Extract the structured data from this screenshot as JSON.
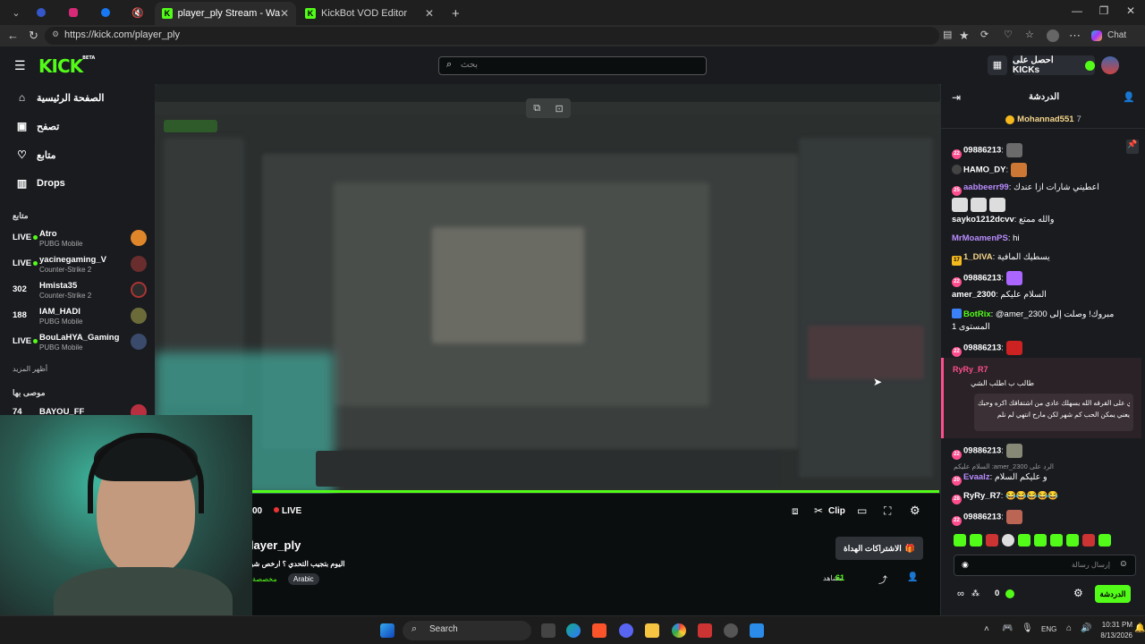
{
  "browser": {
    "tabs": [
      {
        "title": "player_ply Stream - Watch Live on Kick",
        "active": true
      },
      {
        "title": "KickBot VOD Editor",
        "active": false
      }
    ],
    "new_tab": "+",
    "url": "https://kick.com/player_ply",
    "copilot_label": "Chat"
  },
  "header": {
    "logo": "KICK",
    "logo_badge": "BETA",
    "search_placeholder": "بحث",
    "kicks_button": "احصل على KICKs"
  },
  "sidebar": {
    "nav": [
      {
        "label": "الصفحة الرئيسية",
        "icon": "home-icon"
      },
      {
        "label": "تصفح",
        "icon": "browse-icon"
      },
      {
        "label": "متابع",
        "icon": "heart-icon"
      },
      {
        "label": "Drops",
        "icon": "drops-icon"
      }
    ],
    "following_title": "متابع",
    "following": [
      {
        "status": "LIVE",
        "name": "Atro",
        "game": "PUBG Mobile"
      },
      {
        "status": "LIVE",
        "name": "yacinegaming_V",
        "game": "Counter-Strike 2"
      },
      {
        "status": "302",
        "name": "Hmista35",
        "game": "Counter-Strike 2"
      },
      {
        "status": "188",
        "name": "IAM_HADI",
        "game": "PUBG Mobile"
      },
      {
        "status": "LIVE",
        "name": "BouLaHYA_Gaming",
        "game": "PUBG Mobile"
      }
    ],
    "show_more": "أظهر المزيد",
    "recommended_title": "موصى بها",
    "recommended": [
      {
        "status": "74",
        "name": "BAYOU_FF"
      }
    ]
  },
  "player": {
    "time": "00",
    "live_label": "LIVE",
    "clip_label": "Clip"
  },
  "stream_info": {
    "channel": "player_ply",
    "title": "اليوم بتجيب التحدي ؟ ارخص شوب",
    "category": "مخصصة",
    "tag": "Arabic",
    "gift_button": "الاشتراكات الهداة",
    "viewers_label": "مشاهد",
    "viewers": "61"
  },
  "chat": {
    "title": "الدردشة",
    "pinned_user": "Mohannad551",
    "pinned_count": "7",
    "messages": [
      {
        "badge": "22",
        "user": "09886213",
        "text": "",
        "color": "#ffffff",
        "emote": true
      },
      {
        "badge": "",
        "user": "HAMO_DY",
        "text": "",
        "color": "#ffffff",
        "emote": true
      },
      {
        "badge": "25",
        "user": "aabbeerr99",
        "text": "اعطيني شارات ازا عندك",
        "color": "#ffffff"
      },
      {
        "badge": "",
        "user": "sayko1212dcvv",
        "text": "والله ممتع",
        "color": "#ffffff"
      },
      {
        "badge": "",
        "user": "MrMoamenPS",
        "text": "hi",
        "color": "#b98cff"
      },
      {
        "badge": "17",
        "user": "1_DIVA",
        "text": "يسطيك المافية",
        "color": "#ffffff"
      },
      {
        "badge": "22",
        "user": "09886213",
        "text": "",
        "color": "#ffffff",
        "emote": true
      },
      {
        "badge": "",
        "user": "amer_2300",
        "text": "السلام عليكم",
        "color": "#ffffff"
      },
      {
        "badge": "",
        "user": "BotRix",
        "text": "@amer_2300 مبروك! وصلت إلى المستوى 1",
        "color": "#53fc18"
      },
      {
        "badge": "22",
        "user": "09886213",
        "text": "",
        "color": "#ffffff",
        "emote": true
      }
    ],
    "highlight": {
      "user": "RyRy_R7",
      "line1": "طالب ب اطلب الشي",
      "line2": "لو تلاي على القرقه الله يسهلك عادي من اشتقاقك اكره وحبك",
      "line3": "يعني يمكن الحب كم شهر لكن مارح انتهي لم نلم"
    },
    "after": [
      {
        "badge": "22",
        "user": "09886213",
        "text": "",
        "emote": true
      },
      {
        "reply": "السلام عليكم :amer_2300 الرد على",
        "badge": "20",
        "user": "Evaalz",
        "text": "و عليكم السلام"
      },
      {
        "badge": "28",
        "user": "RyRy_R7",
        "text": "😂😂😂😂😂"
      },
      {
        "badge": "22",
        "user": "09886213",
        "text": "",
        "emote": true
      }
    ],
    "input_placeholder": "إرسال رسالة",
    "kicks_count": "0",
    "send_button": "الدردشة"
  },
  "taskbar": {
    "search": "Search",
    "lang": "ENG",
    "time": "10:31 PM",
    "date": "8/13/2026"
  }
}
